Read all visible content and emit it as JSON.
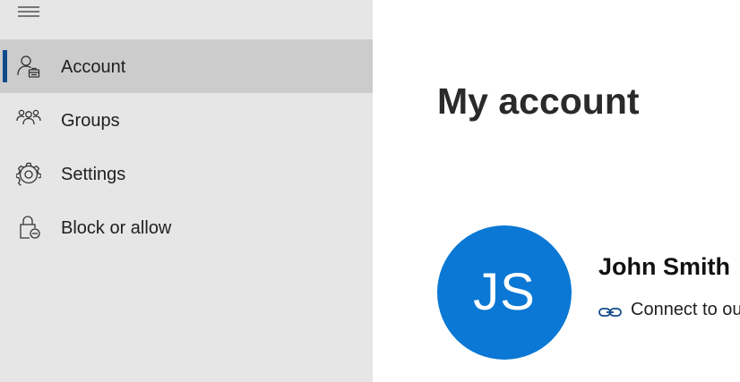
{
  "sidebar": {
    "menu_icon": "hamburger-icon",
    "items": [
      {
        "label": "Account",
        "icon": "account-icon",
        "selected": true
      },
      {
        "label": "Groups",
        "icon": "groups-icon",
        "selected": false
      },
      {
        "label": "Settings",
        "icon": "gear-icon",
        "selected": false
      },
      {
        "label": "Block or allow",
        "icon": "lock-block-icon",
        "selected": false
      }
    ]
  },
  "main": {
    "title": "My account",
    "profile": {
      "initials": "JS",
      "name": "John Smith",
      "connect_label": "Connect to ou",
      "connect_icon": "link-icon"
    }
  },
  "colors": {
    "sidebar_bg": "#e6e6e6",
    "selected_bg": "#cccccc",
    "selection_indicator": "#0f4a8a",
    "avatar_bg": "#0a78d4",
    "link_icon": "#0f4a8a"
  }
}
